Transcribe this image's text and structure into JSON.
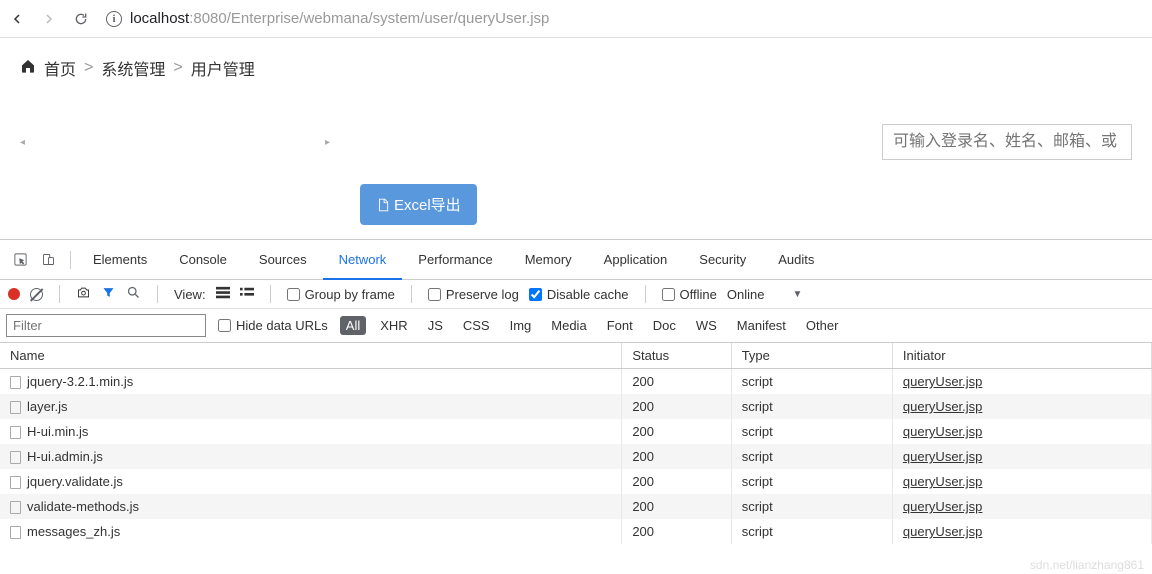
{
  "browser": {
    "url_prefix": "localhost",
    "url_path": ":8080/Enterprise/webmana/system/user/queryUser.jsp"
  },
  "breadcrumb": {
    "home": "首页",
    "sep": ">",
    "level1": "系统管理",
    "level2": "用户管理"
  },
  "search_placeholder": "可输入登录名、姓名、邮箱、或",
  "excel_button": "Excel导出",
  "devtools": {
    "tabs": [
      "Elements",
      "Console",
      "Sources",
      "Network",
      "Performance",
      "Memory",
      "Application",
      "Security",
      "Audits"
    ],
    "active_tab": "Network",
    "toolbar": {
      "view_label": "View:",
      "group_by_frame": "Group by frame",
      "preserve_log": "Preserve log",
      "disable_cache": "Disable cache",
      "offline": "Offline",
      "online": "Online"
    },
    "filter": {
      "placeholder": "Filter",
      "hide_urls": "Hide data URLs",
      "types": [
        "All",
        "XHR",
        "JS",
        "CSS",
        "Img",
        "Media",
        "Font",
        "Doc",
        "WS",
        "Manifest",
        "Other"
      ],
      "active_type": "All"
    },
    "table": {
      "headers": {
        "name": "Name",
        "status": "Status",
        "type": "Type",
        "initiator": "Initiator"
      },
      "rows": [
        {
          "name": "jquery-3.2.1.min.js",
          "status": "200",
          "type": "script",
          "initiator": "queryUser.jsp"
        },
        {
          "name": "layer.js",
          "status": "200",
          "type": "script",
          "initiator": "queryUser.jsp"
        },
        {
          "name": "H-ui.min.js",
          "status": "200",
          "type": "script",
          "initiator": "queryUser.jsp"
        },
        {
          "name": "H-ui.admin.js",
          "status": "200",
          "type": "script",
          "initiator": "queryUser.jsp"
        },
        {
          "name": "jquery.validate.js",
          "status": "200",
          "type": "script",
          "initiator": "queryUser.jsp"
        },
        {
          "name": "validate-methods.js",
          "status": "200",
          "type": "script",
          "initiator": "queryUser.jsp"
        },
        {
          "name": "messages_zh.js",
          "status": "200",
          "type": "script",
          "initiator": "queryUser.jsp"
        }
      ]
    }
  },
  "watermark": "sdn.net/lianzhang861"
}
